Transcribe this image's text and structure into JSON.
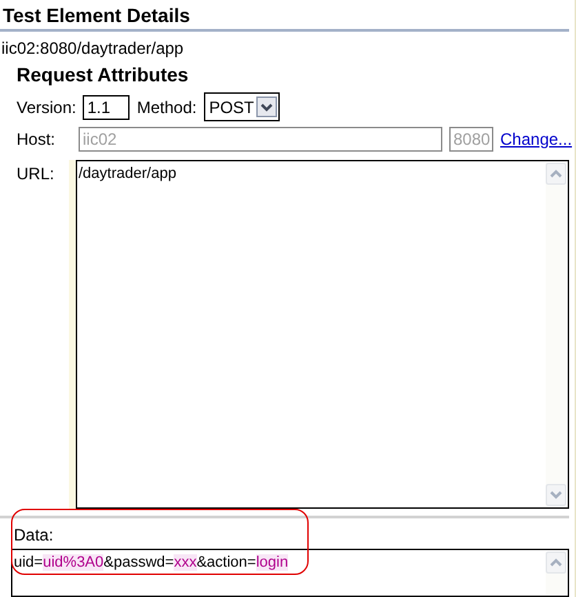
{
  "header": {
    "title": "Test Element Details",
    "path": "iic02:8080/daytrader/app"
  },
  "section": {
    "title": "Request Attributes"
  },
  "version": {
    "label": "Version:",
    "value": "1.1"
  },
  "method": {
    "label": "Method:",
    "value": "POST"
  },
  "host": {
    "label": "Host:",
    "value": "iic02",
    "disabled": true,
    "port": "8080",
    "port_disabled": true,
    "link": "Change..."
  },
  "url": {
    "label": "URL:",
    "value": "/daytrader/app"
  },
  "data": {
    "label": "Data:",
    "highlighted": true,
    "segments": [
      {
        "text": "uid=",
        "kind": "plain"
      },
      {
        "text": "uid%3A0",
        "kind": "value"
      },
      {
        "text": "&passwd=",
        "kind": "plain"
      },
      {
        "text": "xxx",
        "kind": "value"
      },
      {
        "text": "&action=",
        "kind": "plain"
      },
      {
        "text": "login",
        "kind": "value"
      }
    ]
  }
}
